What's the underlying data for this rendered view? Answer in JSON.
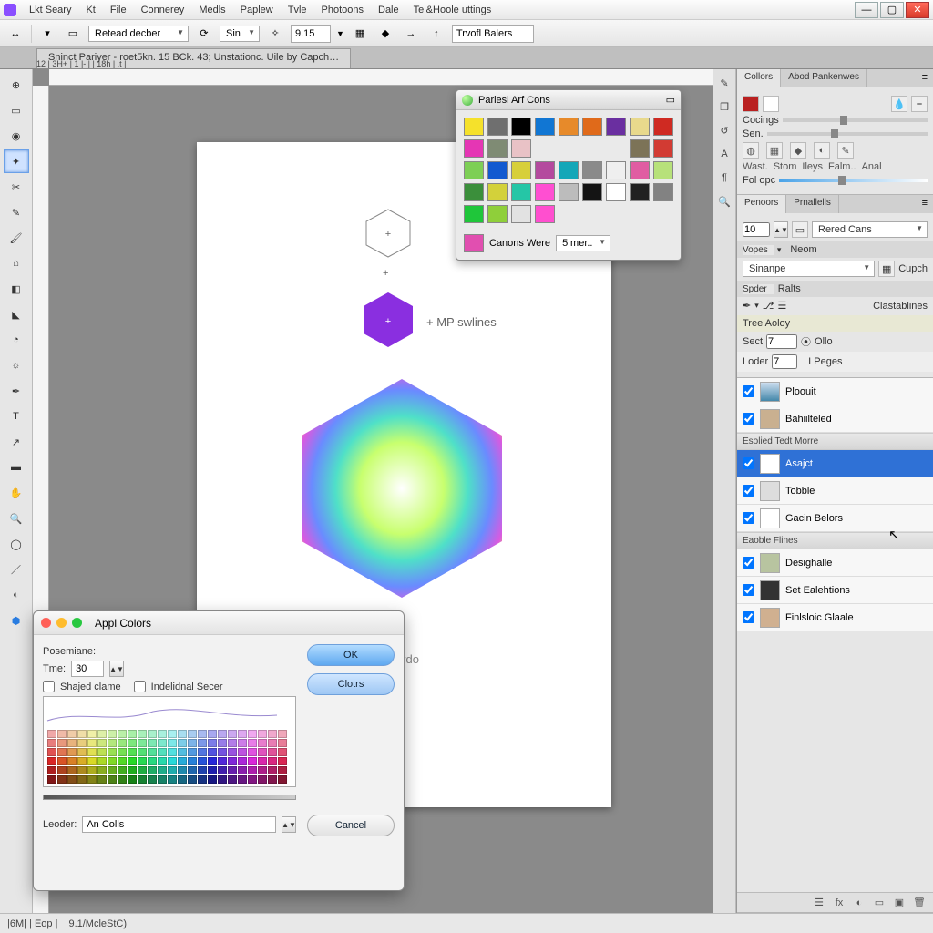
{
  "app": {
    "title_fragments": [
      "Lkt Seary",
      "Kt",
      "File",
      "Connerey",
      "Medls",
      "Paplew",
      "Tvle",
      "Photoons",
      "Dale",
      "Tel&Hoole uttings"
    ]
  },
  "optbar": {
    "dropdown1": "Retead decber",
    "dropdown2": "Sin",
    "num": "9.15",
    "text_input": "Trvofl Balers"
  },
  "doctab": {
    "label": "Sninct Pariyer - roet5kn. 15 BCk. 43; Unstationc. Uile by Capch…"
  },
  "rulerinfo": "12 | 3H+ | 1 |-|| | 18h | .t |",
  "canvas": {
    "label_line": "+ MP swlines",
    "bottom_word": "rfordo"
  },
  "swatch_float": {
    "title": "Parlesl Arf Cons",
    "footer_label": "Canons  Were",
    "footer_dd": "5|mer..",
    "rows": [
      [
        "#f5e12b",
        "#6f6f6f",
        "#000000",
        "#1176d3",
        "#e78a2a",
        "#e06a1a",
        "#6a2fa0",
        "#e8d98c"
      ],
      [
        "#cf2a22",
        "#e536b4",
        "#7f8b74",
        "#e9c2c6"
      ],
      [
        "#7c7357",
        "#d23b33",
        "#7dcf55",
        "#1259d0",
        "#d7cf3a",
        "#b44a9e",
        "#14a7b8",
        "#8a8a8a"
      ],
      [
        "#efefef",
        "#e05da2",
        "#b7e17a",
        "#3b8f3b",
        "#d3d13a",
        "#25c6a6",
        "#ff4fd2",
        "#bcbcbc"
      ],
      [
        "#141414",
        "#ffffff",
        "#212121",
        "#828282",
        "#1fc63a",
        "#8fcf3a",
        "#e2e2e2",
        "#ff4fcf"
      ]
    ]
  },
  "right": {
    "tabs1": [
      "Collors",
      "Abod Pankenwes"
    ],
    "labels": {
      "cocings": "Cocings",
      "sen": "Sen.",
      "wast": "Wast.",
      "stom": "Stom",
      "ileys": "Ileys",
      "falm": "Falm..",
      "anal": "Anal",
      "folopc": "Fol opc"
    },
    "tabs2": [
      "Penoors",
      "Prnallells"
    ],
    "num": "10",
    "rered": "Rered Cans",
    "section_tabs": [
      "Vopes",
      "Neom"
    ],
    "sinanpe": "Sinanpe",
    "cupch": "Cupch",
    "spder_tabs": [
      "Spder",
      "Ralts"
    ],
    "clastab": "Clastablines",
    "tree": "Tree Aoloy",
    "sect": "Sect",
    "sect_val": "7",
    "ollo": "Ollo",
    "loder": "Loder",
    "loder_val": "7",
    "ipeges": "I Peges",
    "group1": "Esolied Tedt Morre",
    "group2": "Eaoble Flines",
    "layers": [
      {
        "name": "Ploouit",
        "sel": false
      },
      {
        "name": "Bahiilteled",
        "sel": false
      }
    ],
    "layers_g1": [
      {
        "name": "Asajct",
        "sel": true
      },
      {
        "name": "Tobble",
        "sel": false
      },
      {
        "name": "Gacin Belors",
        "sel": false
      }
    ],
    "layers_g2": [
      {
        "name": "Desighalle",
        "sel": false
      },
      {
        "name": "Set Ealehtions",
        "sel": false
      },
      {
        "name": "Finlsloic Glaale",
        "sel": false
      }
    ]
  },
  "dialog": {
    "title": "Appl Colors",
    "posemiane": "Posemiane:",
    "time": "Tme:",
    "time_val": "30",
    "shajed": "Shajed clame",
    "indiv": "Indelidnal Secer",
    "leoder": "Leoder:",
    "leoder_val": "An Colls",
    "ok": "OK",
    "clotrs": "Clotrs",
    "cancel": "Cancel"
  },
  "status": {
    "left": "|6M| | Eop |",
    "zoom": "9.1/McleStC)"
  },
  "colors": {
    "accent": "#2f71d6",
    "canvas": "#8a8a8a"
  }
}
